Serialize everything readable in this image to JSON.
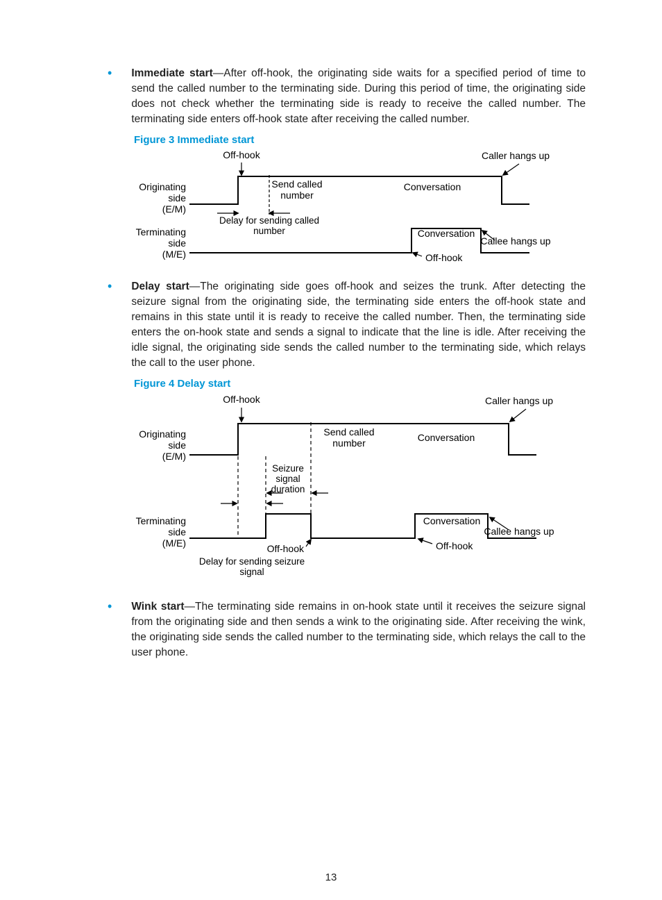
{
  "items": [
    {
      "title": "Immediate start",
      "body": "—After off-hook, the originating side waits for a specified period of time to send the called number to the terminating side. During this period of time, the originating side does not check whether the terminating side is ready to receive the called number. The terminating side enters off-hook state after receiving the called number."
    },
    {
      "title": "Delay start",
      "body": "—The originating side goes off-hook and seizes the trunk. After detecting the seizure signal from the originating side, the terminating side enters the off-hook state and remains in this state until it is ready to receive the called number. Then, the terminating side enters the on-hook state and sends a signal to indicate that the line is idle. After receiving the idle signal, the originating side sends the called number to the terminating side, which relays the call to the user phone."
    },
    {
      "title": "Wink start",
      "body": "—The terminating side remains in on-hook state until it receives the seizure signal from the originating side and then sends a wink to the originating side. After receiving the wink, the originating side sends the called number to the terminating side, which relays the call to the user phone."
    }
  ],
  "figures": {
    "fig3": {
      "caption": "Figure 3 Immediate start"
    },
    "fig4": {
      "caption": "Figure 4 Delay start"
    }
  },
  "fig3_labels": {
    "off_hook_top": "Off-hook",
    "caller_hangs_up": "Caller hangs up",
    "originating_side": "Originating",
    "side1": "side",
    "em": "(E/M)",
    "send_called": "Send called",
    "number1": "number",
    "conversation1": "Conversation",
    "delay_send": "Delay for sending called",
    "number2": "number",
    "terminating_side": "Terminating",
    "side2": "side",
    "me": "(M/E)",
    "conversation2": "Conversation",
    "callee_hangs_up": "Callee hangs up",
    "off_hook_bot": "Off-hook"
  },
  "fig4_labels": {
    "off_hook_top": "Off-hook",
    "caller_hangs_up": "Caller hangs up",
    "originating_side": "Originating",
    "side1": "side",
    "em": "(E/M)",
    "send_called": "Send called",
    "number1": "number",
    "conversation1": "Conversation",
    "seizure": "Seizure",
    "signal1": "signal",
    "duration": "duration",
    "terminating_side": "Terminating",
    "side2": "side",
    "me": "(M/E)",
    "off_hook_mid": "Off-hook",
    "conversation2": "Conversation",
    "off_hook_bot": "Off-hook",
    "callee_hangs_up": "Callee hangs up",
    "delay_seizure1": "Delay for sending seizure",
    "delay_seizure2": "signal"
  },
  "page_number": "13"
}
